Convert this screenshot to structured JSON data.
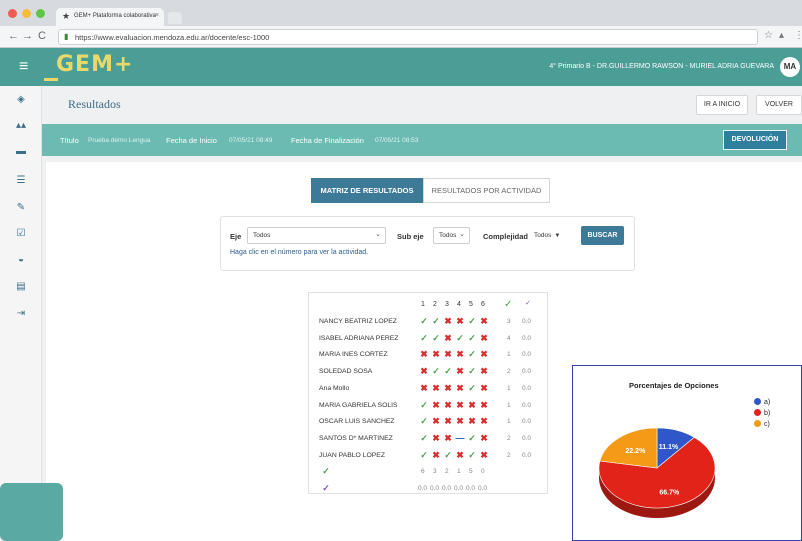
{
  "browser": {
    "tab_title": "GEM+ Plataforma colaborativa",
    "url": "https://www.evaluacion.mendoza.edu.ar/docente/esc-1000"
  },
  "header": {
    "logo": "GEM+",
    "user_context": "4° Primario B - DR.GUILLERMO RAWSON - MURIEL ADRIA GUEVARA",
    "avatar": "MA"
  },
  "page": {
    "title": "Resultados",
    "btn_inicio": "IR A INICIO",
    "btn_volver": "VOLVER"
  },
  "info": {
    "titulo_label": "Título",
    "titulo_value": "Prueba demo Lengua",
    "inicio_label": "Fecha de Inicio",
    "inicio_value": "07/05/21 08:49",
    "fin_label": "Fecha de Finalización",
    "fin_value": "07/05/21 08:53",
    "btn_devolucion": "DEVOLUCIÓN"
  },
  "tabs": {
    "matriz": "MATRIZ DE RESULTADOS",
    "actividad": "RESULTADOS POR ACTIVIDAD"
  },
  "filters": {
    "eje_label": "Eje",
    "eje_value": "Todos",
    "subeje_label": "Sub eje",
    "subeje_value": "Todos",
    "complejidad_label": "Complejidad",
    "complejidad_value": "Todos",
    "buscar": "BUSCAR",
    "help": "Haga clic en el número para ver la actividad."
  },
  "matrix": {
    "columns": [
      "1",
      "2",
      "3",
      "4",
      "5",
      "6"
    ],
    "rows": [
      {
        "name": "NANCY BEATRIZ LOPEZ",
        "marks": [
          "ok",
          "ok",
          "bad",
          "bad",
          "ok",
          "bad"
        ],
        "correct": "3",
        "pct": "0.0"
      },
      {
        "name": "ISABEL ADRIANA PEREZ",
        "marks": [
          "ok",
          "ok",
          "bad",
          "ok",
          "ok",
          "bad"
        ],
        "correct": "4",
        "pct": "0.0"
      },
      {
        "name": "MARIA INES CORTEZ",
        "marks": [
          "bad",
          "bad",
          "bad",
          "bad",
          "ok",
          "bad"
        ],
        "correct": "1",
        "pct": "0.0"
      },
      {
        "name": "SOLEDAD SOSA",
        "marks": [
          "bad",
          "ok",
          "ok",
          "bad",
          "ok",
          "bad"
        ],
        "correct": "2",
        "pct": "0.0"
      },
      {
        "name": "Ana Mollo",
        "marks": [
          "bad",
          "bad",
          "bad",
          "bad",
          "ok",
          "bad"
        ],
        "correct": "1",
        "pct": "0.0"
      },
      {
        "name": "MARIA GABRIELA SOLIS",
        "marks": [
          "ok",
          "bad",
          "bad",
          "bad",
          "bad",
          "bad"
        ],
        "correct": "1",
        "pct": "0.0"
      },
      {
        "name": "OSCAR LUIS SANCHEZ",
        "marks": [
          "ok",
          "bad",
          "bad",
          "bad",
          "bad",
          "bad"
        ],
        "correct": "1",
        "pct": "0.0"
      },
      {
        "name": "SANTOS D* MARTINEZ",
        "marks": [
          "ok",
          "bad",
          "bad",
          "dash",
          "ok",
          "bad"
        ],
        "correct": "2",
        "pct": "0.0"
      },
      {
        "name": "JUAN PABLO LOPEZ",
        "marks": [
          "ok",
          "bad",
          "ok",
          "bad",
          "ok",
          "bad"
        ],
        "correct": "2",
        "pct": "0.0"
      }
    ],
    "totals_correct": [
      "6",
      "3",
      "2",
      "1",
      "5",
      "0"
    ],
    "totals_pct": [
      "0.0",
      "0.0",
      "0.0",
      "0.0",
      "0.0",
      "0.0"
    ]
  },
  "chart_data": {
    "type": "pie",
    "title": "Porcentajes de Opciones",
    "categories": [
      "a)",
      "b)",
      "c)"
    ],
    "values": [
      11.1,
      66.7,
      22.2
    ],
    "labels": [
      "11.1%",
      "66.7%",
      "22.2%"
    ],
    "colors": [
      "#2f57c9",
      "#e2231a",
      "#f59a16"
    ],
    "legend": "right"
  }
}
